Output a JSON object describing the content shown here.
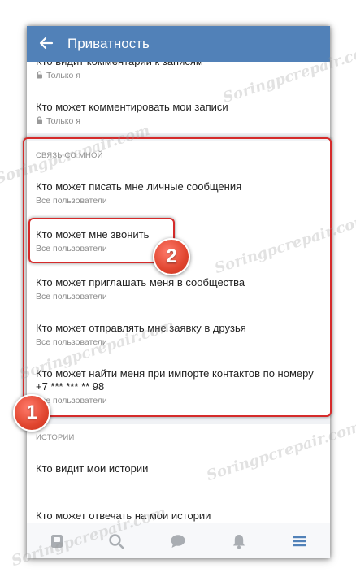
{
  "header": {
    "title": "Приватность"
  },
  "items": [
    {
      "title": "Кто видит комментарии к записям",
      "subtitle": "Только я",
      "locked": true
    },
    {
      "title": "Кто может комментировать мои записи",
      "subtitle": "Только я",
      "locked": true
    },
    {
      "title": "Кто может писать мне личные сообщения",
      "subtitle": "Все пользователи"
    },
    {
      "title": "Кто может мне звонить",
      "subtitle": "Все пользователи"
    },
    {
      "title": "Кто может приглашать меня в сообщества",
      "subtitle": "Все пользователи"
    },
    {
      "title": "Кто может отправлять мне заявку в друзья",
      "subtitle": "Все пользователи"
    },
    {
      "title": "Кто может найти меня при импорте контактов по номеру",
      "title_line2": "+7 *** *** ** 98",
      "subtitle": "Все пользователи"
    },
    {
      "title": "Кто видит мои истории"
    },
    {
      "title": "Кто может отвечать на мои истории"
    }
  ],
  "sections": {
    "contact": "Связь со мной",
    "stories": "Истории"
  },
  "badges": {
    "one": "1",
    "two": "2"
  },
  "watermark": "Soringpcrepair.com",
  "colors": {
    "header": "#5181b8",
    "highlight": "#d52b2b",
    "badge": "#e0452f"
  },
  "tabbar": {
    "icons": [
      "news-icon",
      "search-icon",
      "messages-icon",
      "notifications-icon",
      "menu-icon"
    ],
    "active": "menu-icon"
  }
}
